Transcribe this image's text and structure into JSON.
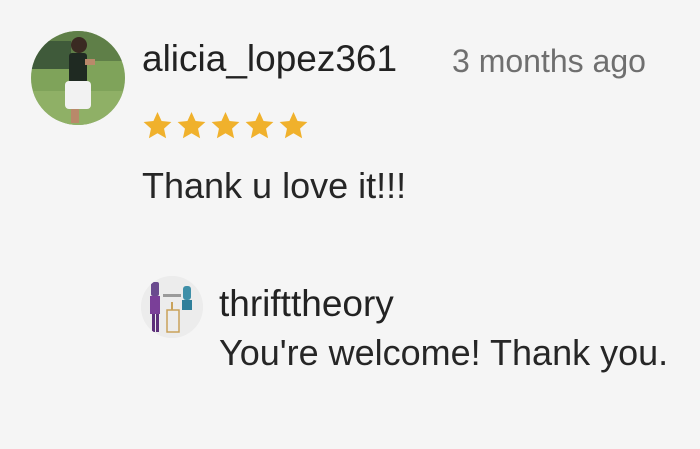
{
  "review": {
    "username": "alicia_lopez361",
    "timestamp": "3 months ago",
    "rating": 5,
    "rating_max": 5,
    "text": "Thank u love it!!!",
    "star_color": "#f0b12c"
  },
  "reply": {
    "shop_name": "thrifttheory",
    "text": "You're welcome! Thank you."
  }
}
